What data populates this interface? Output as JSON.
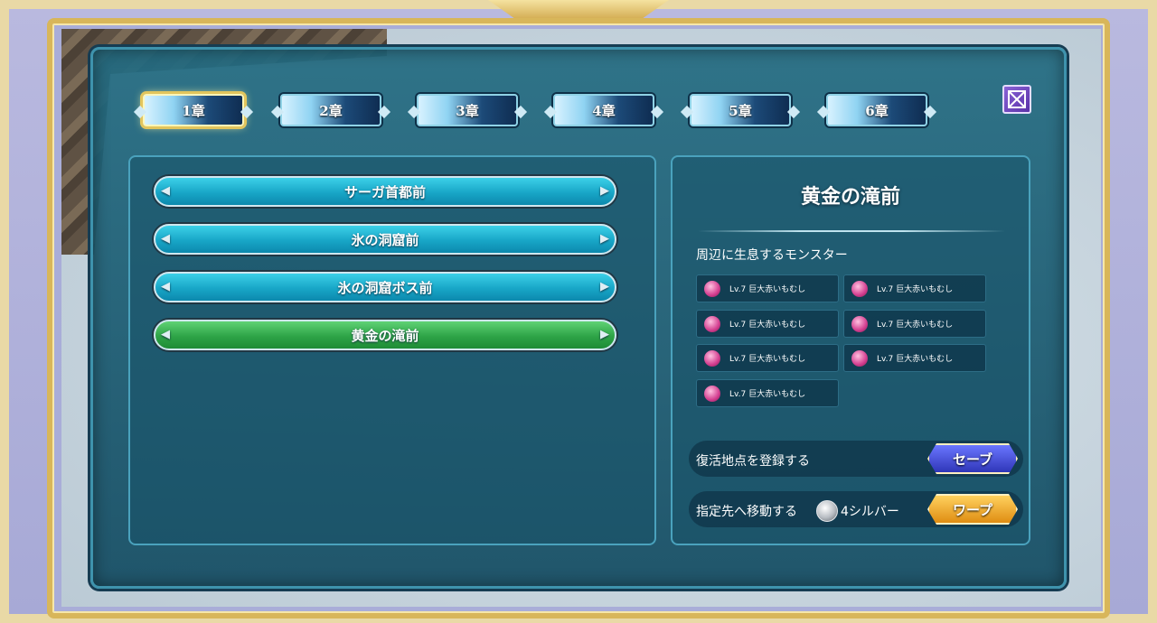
{
  "tabs": [
    {
      "label": "1章",
      "active": true
    },
    {
      "label": "2章",
      "active": false
    },
    {
      "label": "3章",
      "active": false
    },
    {
      "label": "4章",
      "active": false
    },
    {
      "label": "5章",
      "active": false
    },
    {
      "label": "6章",
      "active": false
    }
  ],
  "locations": [
    {
      "label": "サーガ首都前",
      "selected": false
    },
    {
      "label": "氷の洞窟前",
      "selected": false
    },
    {
      "label": "氷の洞窟ボス前",
      "selected": false
    },
    {
      "label": "黄金の滝前",
      "selected": true
    }
  ],
  "detail": {
    "title": "黄金の滝前",
    "monsters_label": "周辺に生息するモンスター",
    "monsters": [
      "Lv.7 巨大赤いもむし",
      "Lv.7 巨大赤いもむし",
      "Lv.7 巨大赤いもむし",
      "Lv.7 巨大赤いもむし",
      "Lv.7 巨大赤いもむし",
      "Lv.7 巨大赤いもむし",
      "Lv.7 巨大赤いもむし"
    ],
    "save_row_text": "復活地点を登録する",
    "save_button": "セーブ",
    "warp_row_text": "指定先へ移動する",
    "warp_cost": "4シルバー",
    "warp_button": "ワープ"
  },
  "colors": {
    "panel": "#1f6b82",
    "selected_bar": "#2ea447",
    "bar": "#18a6c7",
    "save_button": "#3a43c8",
    "warp_button": "#eea020",
    "frame_gold": "#d8b65a"
  }
}
